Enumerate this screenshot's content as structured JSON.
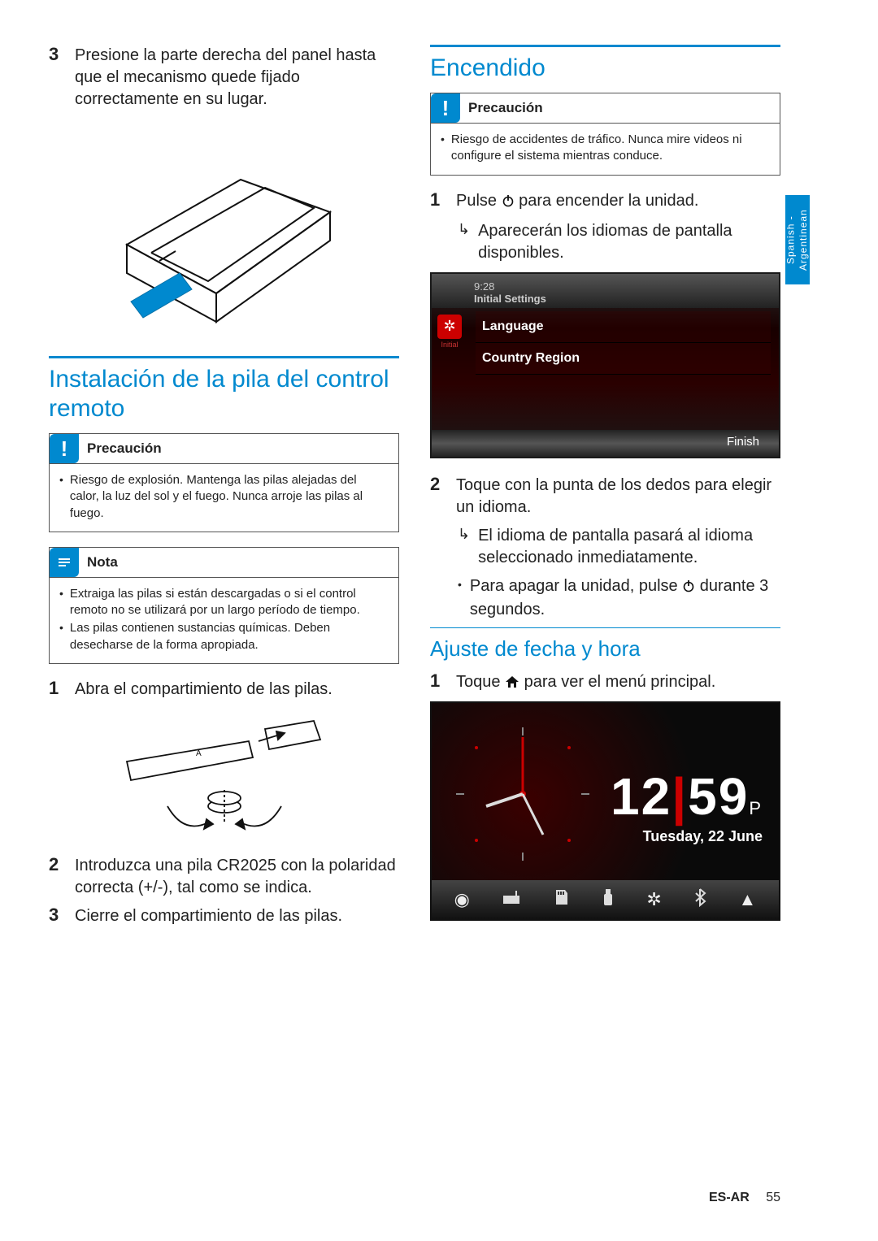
{
  "left": {
    "step3": {
      "num": "3",
      "text": "Presione la parte derecha del panel hasta que el mecanismo quede fijado correctamente en su lugar."
    },
    "section_title": "Instalación de la pila del control remoto",
    "caution": {
      "label": "Precaución",
      "items": [
        "Riesgo de explosión. Mantenga las pilas alejadas del calor, la luz del sol y el fuego. Nunca arroje las pilas al fuego."
      ]
    },
    "note": {
      "label": "Nota",
      "items": [
        "Extraiga las pilas si están descargadas o si el control remoto no se utilizará por un largo período de tiempo.",
        "Las pilas contienen sustancias químicas. Deben desecharse de la forma apropiada."
      ]
    },
    "b_step1": {
      "num": "1",
      "text": "Abra el compartimiento de las pilas."
    },
    "b_step2": {
      "num": "2",
      "text": "Introduzca una pila CR2025 con la polaridad correcta (+/-), tal como se indica."
    },
    "b_step3": {
      "num": "3",
      "text": "Cierre el compartimiento de las pilas."
    }
  },
  "right": {
    "section_title": "Encendido",
    "caution": {
      "label": "Precaución",
      "items": [
        "Riesgo de accidentes de tráfico. Nunca mire videos ni configure el sistema mientras conduce."
      ]
    },
    "step1": {
      "num": "1",
      "text_before": "Pulse ",
      "text_after": " para encender la unidad.",
      "arrow": "Aparecerán los idiomas de pantalla disponibles."
    },
    "screen1": {
      "time": "9:28",
      "title": "Initial Settings",
      "side_label": "Initial",
      "rows": [
        "Language",
        "Country Region"
      ],
      "finish": "Finish"
    },
    "step2": {
      "num": "2",
      "text": "Toque con la punta de los dedos para elegir un idioma.",
      "arrow": "El idioma de pantalla pasará al idioma seleccionado inmediatamente.",
      "bullet_before": "Para apagar la unidad, pulse ",
      "bullet_after": " durante 3 segundos."
    },
    "sub_title": "Ajuste de fecha y hora",
    "c_step1": {
      "num": "1",
      "text_before": "Toque ",
      "text_after": " para ver el menú principal."
    },
    "screen2": {
      "hour": "12",
      "minute": "59",
      "ampm": "P",
      "date": "Tuesday, 22 June"
    }
  },
  "lang_tab": "Spanish - Argentinean",
  "footer": {
    "lang": "ES-AR",
    "page": "55"
  }
}
